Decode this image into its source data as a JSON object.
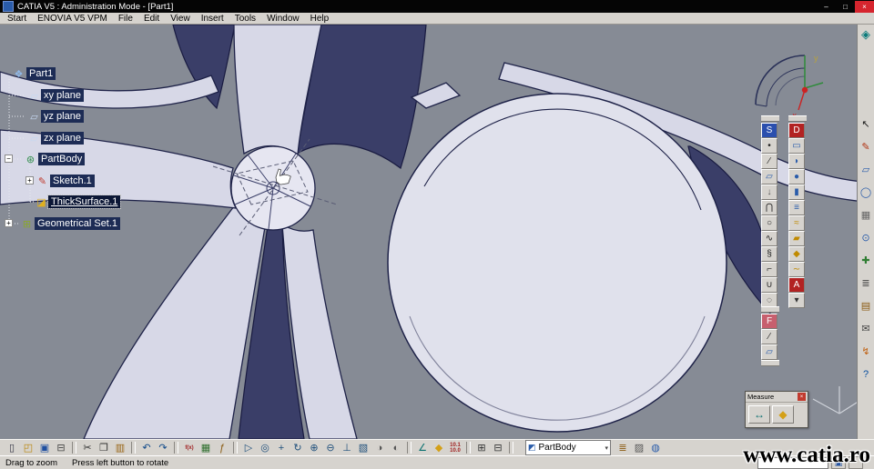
{
  "colors": {
    "titlebar_bg": "#050505",
    "close_button": "#d6252e",
    "menubar_bg": "#d6d3ce",
    "viewport_bg": "#868b95",
    "model_light": "#d7d8e7",
    "model_dark": "#3a3e68",
    "model_edge": "#1e2248",
    "tree_label_bg": "#1d2c55",
    "selection_bg": "#0c1736"
  },
  "window": {
    "app_title": "CATIA V5 : Administration Mode - [Part1]",
    "minimize_glyph": "–",
    "maximize_glyph": "□",
    "close_glyph": "×"
  },
  "menu": {
    "items": [
      {
        "name": "menu-item-start",
        "label": "Start"
      },
      {
        "name": "menu-item-enovia-v5-vpm",
        "label": "ENOVIA V5 VPM"
      },
      {
        "name": "menu-item-file",
        "label": "File"
      },
      {
        "name": "menu-item-edit",
        "label": "Edit"
      },
      {
        "name": "menu-item-view",
        "label": "View"
      },
      {
        "name": "menu-item-insert",
        "label": "Insert"
      },
      {
        "name": "menu-item-tools",
        "label": "Tools"
      },
      {
        "name": "menu-item-window",
        "label": "Window"
      },
      {
        "name": "menu-item-help",
        "label": "Help"
      }
    ]
  },
  "tree": {
    "expand_expanded": "−",
    "expand_collapsed": "+",
    "items": [
      {
        "label": "Part1",
        "glyph": "❖"
      },
      {
        "label": "xy plane",
        "glyph": "▱"
      },
      {
        "label": "yz plane",
        "glyph": "▱"
      },
      {
        "label": "zx plane",
        "glyph": "▱"
      },
      {
        "label": "PartBody",
        "glyph": "⊛"
      },
      {
        "label": "Sketch.1",
        "glyph": "✎"
      },
      {
        "label": "ThickSurface.1",
        "glyph": "◪",
        "selected": true
      },
      {
        "label": "Geometrical Set.1",
        "glyph": "⊞"
      }
    ]
  },
  "compass": {
    "x_label": "x",
    "y_label": "y"
  },
  "right_dock": {
    "workbench_icon": {
      "name": "wireframe-surface-workbench-icon",
      "glyph": "◈"
    },
    "icons": [
      {
        "name": "select-arrow-icon",
        "glyph": "↖",
        "fg": "#1a1a1a"
      },
      {
        "name": "sketcher-icon",
        "glyph": "✎",
        "fg": "#b03010"
      },
      {
        "name": "pad-icon",
        "glyph": "▱",
        "fg": "#2a5caa"
      },
      {
        "name": "magnifier-icon",
        "glyph": "◯",
        "fg": "#2a5caa"
      },
      {
        "name": "grid-icon",
        "glyph": "▦",
        "fg": "#666666"
      },
      {
        "name": "snap-icon",
        "glyph": "⊙",
        "fg": "#2a5caa"
      },
      {
        "name": "axis-system-icon",
        "glyph": "✚",
        "fg": "#2f7d32"
      },
      {
        "name": "layers-icon",
        "glyph": "≣",
        "fg": "#444444"
      },
      {
        "name": "catalog-icon",
        "glyph": "▤",
        "fg": "#8a5a10"
      },
      {
        "name": "mail-icon",
        "glyph": "✉",
        "fg": "#444444"
      },
      {
        "name": "power-copy-icon",
        "glyph": "↯",
        "fg": "#c06010"
      },
      {
        "name": "help-icon",
        "glyph": "?",
        "fg": "#0a50a0"
      }
    ]
  },
  "surfaces_toolbar": {
    "icons": [
      {
        "name": "sketcher-button",
        "glyph": "S",
        "fg": "#ffffff",
        "bg": "#2b4fae"
      },
      {
        "name": "point-button",
        "glyph": "•",
        "fg": "#222222"
      },
      {
        "name": "line-button",
        "glyph": "∕",
        "fg": "#222222"
      },
      {
        "name": "plane-button",
        "glyph": "▱",
        "fg": "#2a5caa"
      },
      {
        "name": "projection-button",
        "glyph": "↓",
        "fg": "#555555"
      },
      {
        "name": "intersection-button",
        "glyph": "⋂",
        "fg": "#222222"
      },
      {
        "name": "circle-button",
        "glyph": "○",
        "fg": "#222222"
      },
      {
        "name": "spline-button",
        "glyph": "∿",
        "fg": "#222222"
      },
      {
        "name": "helix-button",
        "glyph": "§",
        "fg": "#222222"
      },
      {
        "name": "corner-button",
        "glyph": "⌐",
        "fg": "#222222"
      },
      {
        "name": "connect-curve-button",
        "glyph": "∪",
        "fg": "#222222"
      },
      {
        "name": "boundary-button",
        "glyph": "◌",
        "fg": "#222222"
      }
    ]
  },
  "operations_toolbar": {
    "icons": [
      {
        "name": "part-design-button",
        "glyph": "D",
        "fg": "#ffffff",
        "bg": "#b22222"
      },
      {
        "name": "extrude-button",
        "glyph": "▭",
        "fg": "#2a5caa"
      },
      {
        "name": "revolve-button",
        "glyph": "◗",
        "fg": "#2a5caa"
      },
      {
        "name": "sphere-button",
        "glyph": "●",
        "fg": "#2a5caa"
      },
      {
        "name": "cylinder-button",
        "glyph": "▮",
        "fg": "#2a5caa"
      },
      {
        "name": "offset-button",
        "glyph": "≡",
        "fg": "#2a5caa"
      },
      {
        "name": "sweep-button",
        "glyph": "≈",
        "fg": "#c08a00"
      },
      {
        "name": "fill-button",
        "glyph": "▰",
        "fg": "#c08a00"
      },
      {
        "name": "multi-sections-button",
        "glyph": "◆",
        "fg": "#c08a00"
      },
      {
        "name": "blend-button",
        "glyph": "∼",
        "fg": "#c08a00"
      },
      {
        "name": "annotations-button",
        "glyph": "A",
        "fg": "#ffffff",
        "bg": "#b22222"
      },
      {
        "name": "more-tools-button",
        "glyph": "▾",
        "fg": "#333333"
      }
    ]
  },
  "insert_palette": {
    "icons": [
      {
        "name": "insert-mode-button",
        "glyph": "F",
        "fg": "#ffffff",
        "bg": "#c75f6e"
      },
      {
        "name": "axis-line-button",
        "glyph": "∕",
        "fg": "#222222"
      },
      {
        "name": "support-plane-button",
        "glyph": "▱",
        "fg": "#2a5caa"
      }
    ]
  },
  "measure_palette": {
    "title": "Measure",
    "close_glyph": "×",
    "icons": [
      {
        "name": "measure-between-button",
        "glyph": "↔",
        "fg": "#0a7070"
      },
      {
        "name": "measure-inertia-button",
        "glyph": "◆",
        "fg": "#d4a017"
      }
    ]
  },
  "bottom_toolbar": {
    "combo_value": "PartBody",
    "combo_icon": "◩",
    "combo_arrow": "▾",
    "icons": [
      {
        "name": "new-document-button",
        "glyph": "▯",
        "fg": "#333344"
      },
      {
        "name": "open-button",
        "glyph": "◰",
        "fg": "#b8860b"
      },
      {
        "name": "save-button",
        "glyph": "▣",
        "fg": "#1f4fa0"
      },
      {
        "name": "print-button",
        "glyph": "⊟",
        "fg": "#444444"
      },
      {
        "sep": true
      },
      {
        "name": "cut-button",
        "glyph": "✂",
        "fg": "#333333"
      },
      {
        "name": "copy-button",
        "glyph": "❐",
        "fg": "#333333"
      },
      {
        "name": "paste-button",
        "glyph": "▥",
        "fg": "#996515"
      },
      {
        "sep": true
      },
      {
        "name": "undo-button",
        "glyph": "↶",
        "fg": "#104a8a"
      },
      {
        "name": "redo-button",
        "glyph": "↷",
        "fg": "#104a8a"
      },
      {
        "sep": true
      },
      {
        "name": "formula-fx-button",
        "glyph": "f(x)",
        "fg": "#a02020",
        "tiny": true
      },
      {
        "name": "design-table-button",
        "glyph": "▦",
        "fg": "#2f6f2f"
      },
      {
        "name": "knowledge-button",
        "glyph": "ƒ",
        "fg": "#8a5a10"
      },
      {
        "sep": true
      },
      {
        "name": "fly-mode-button",
        "glyph": "▷",
        "fg": "#20507c"
      },
      {
        "name": "fit-all-in-button",
        "glyph": "◎",
        "fg": "#20507c"
      },
      {
        "name": "pan-button",
        "glyph": "+",
        "fg": "#20507c"
      },
      {
        "name": "rotate-button",
        "glyph": "↻",
        "fg": "#20507c"
      },
      {
        "name": "zoom-in-button",
        "glyph": "⊕",
        "fg": "#20507c"
      },
      {
        "name": "zoom-out-button",
        "glyph": "⊖",
        "fg": "#20507c"
      },
      {
        "name": "normal-view-button",
        "glyph": "⊥",
        "fg": "#20507c"
      },
      {
        "name": "quick-view-button",
        "glyph": "▧",
        "fg": "#20507c"
      },
      {
        "name": "render-style-button",
        "glyph": "◑",
        "fg": "#555555"
      },
      {
        "name": "hide-show-button",
        "glyph": "◐",
        "fg": "#555555"
      },
      {
        "sep": true
      },
      {
        "name": "measure-button",
        "glyph": "∠",
        "fg": "#0a7070"
      },
      {
        "name": "mass-properties-button",
        "glyph": "◆",
        "fg": "#d4a017"
      },
      {
        "name": "units-button",
        "glyph": "10.1\n10.0",
        "fg": "#a02020",
        "tiny": true
      },
      {
        "sep": true
      },
      {
        "name": "tree-expand-button",
        "glyph": "⊞",
        "fg": "#333333"
      },
      {
        "name": "tree-collapse-button",
        "glyph": "⊟",
        "fg": "#333333"
      },
      {
        "sep": true
      }
    ],
    "icons_right": [
      {
        "name": "catalog-browser-button",
        "glyph": "≣",
        "fg": "#8a5a10"
      },
      {
        "name": "shape-browser-button",
        "glyph": "▨",
        "fg": "#555555"
      },
      {
        "name": "www-link-button",
        "glyph": "◍",
        "fg": "#2a5caa"
      }
    ]
  },
  "status_bar": {
    "prompt": "Drag to zoom",
    "hint": "Press left button to rotate"
  },
  "watermark": "www.catia.ro"
}
